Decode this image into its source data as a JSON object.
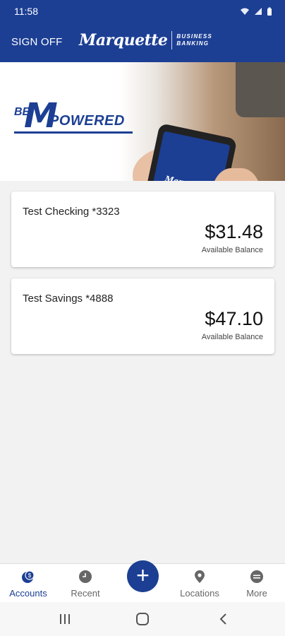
{
  "status_bar": {
    "time": "11:58"
  },
  "header": {
    "sign_off_label": "SIGN OFF",
    "brand_name": "Marquette",
    "brand_sub_line1": "BUSINESS",
    "brand_sub_line2": "BANKING"
  },
  "banner": {
    "be": "BE",
    "m": "M",
    "powered": "POWERED",
    "phone_logo": "Marquette"
  },
  "accounts": [
    {
      "name": "Test Checking *3323",
      "balance": "$31.48",
      "balance_label": "Available Balance"
    },
    {
      "name": "Test Savings *4888",
      "balance": "$47.10",
      "balance_label": "Available Balance"
    }
  ],
  "bottom_nav": {
    "items": [
      {
        "label": "Accounts",
        "icon": "accounts-icon"
      },
      {
        "label": "Recent",
        "icon": "clock-icon"
      },
      {
        "label": "Locations",
        "icon": "location-pin-icon"
      },
      {
        "label": "More",
        "icon": "more-icon"
      }
    ],
    "plus": "+"
  },
  "colors": {
    "brand": "#1c3f94",
    "background": "#f2f2f2",
    "inactive": "#666666"
  }
}
